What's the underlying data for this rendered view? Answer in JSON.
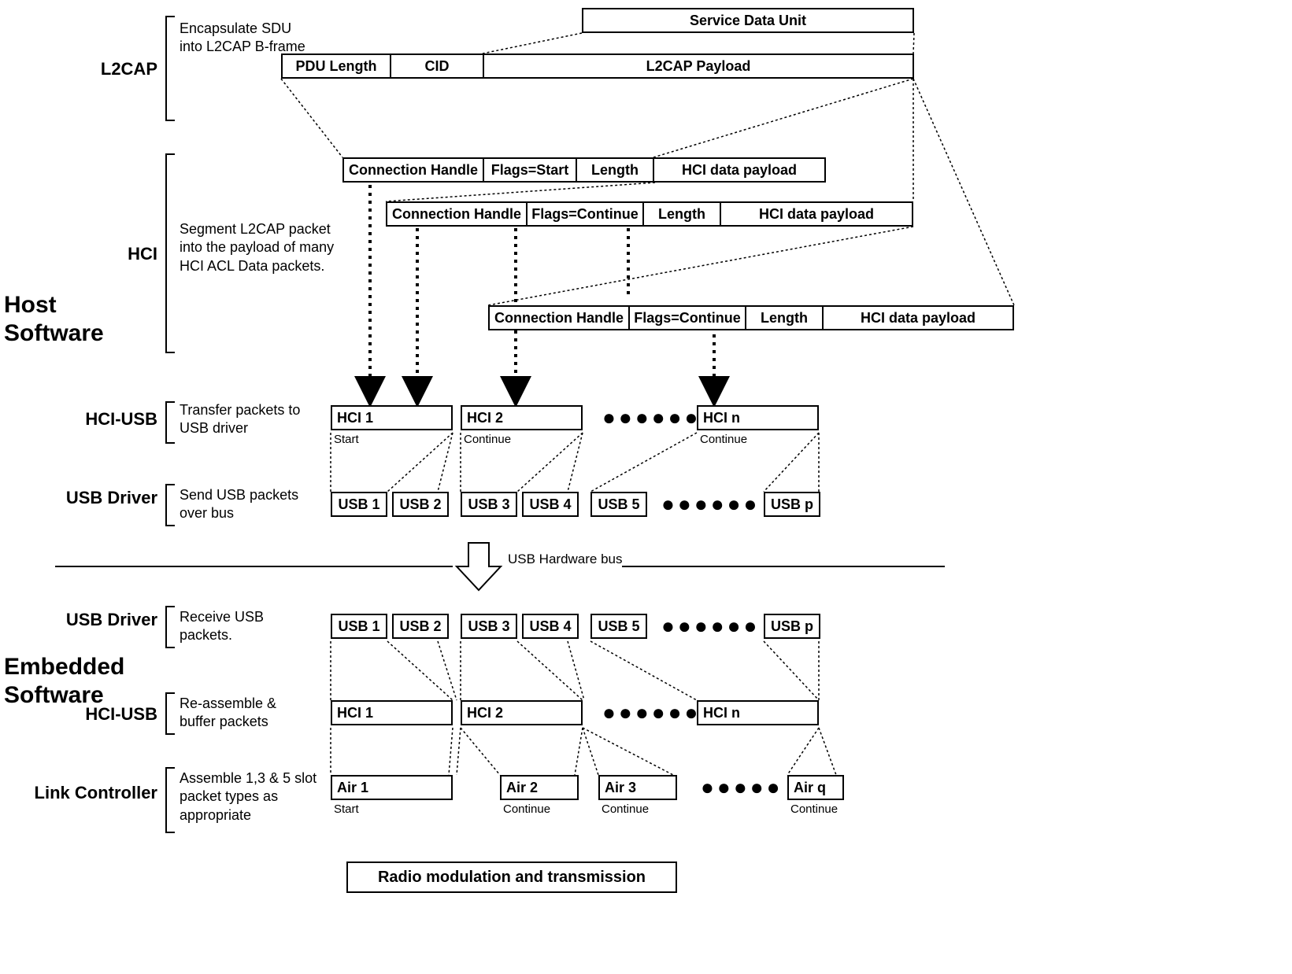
{
  "sections": {
    "host": "Host\nSoftware",
    "embedded": "Embedded\nSoftware"
  },
  "layers": {
    "l2cap": {
      "name": "L2CAP",
      "desc": "Encapsulate SDU into L2CAP B-frame"
    },
    "hci": {
      "name": "HCI",
      "desc": "Segment L2CAP packet into the payload of many HCI ACL Data packets."
    },
    "hci_usb_host": {
      "name": "HCI-USB",
      "desc": "Transfer packets to USB driver"
    },
    "usb_driver_host": {
      "name": "USB Driver",
      "desc": "Send USB packets over bus"
    },
    "usb_driver_emb": {
      "name": "USB Driver",
      "desc": "Receive USB packets."
    },
    "hci_usb_emb": {
      "name": "HCI-USB",
      "desc": "Re-assemble & buffer packets"
    },
    "link_ctrl": {
      "name": "Link Controller",
      "desc": "Assemble 1,3 & 5 slot packet types as appropriate"
    }
  },
  "sdu": "Service Data Unit",
  "l2cap_fields": {
    "pdu_length": "PDU Length",
    "cid": "CID",
    "payload": "L2CAP Payload"
  },
  "hci_fields": {
    "conn_handle": "Connection Handle",
    "flags_start": "Flags=Start",
    "flags_cont": "Flags=Continue",
    "length": "Length",
    "payload": "HCI data payload"
  },
  "hci_blocks": {
    "h1": "HCI 1",
    "h2": "HCI 2",
    "hn": "HCI n"
  },
  "subs": {
    "start": "Start",
    "continue": "Continue"
  },
  "usb_blocks": {
    "u1": "USB 1",
    "u2": "USB 2",
    "u3": "USB 3",
    "u4": "USB 4",
    "u5": "USB 5",
    "up": "USB p"
  },
  "air_blocks": {
    "a1": "Air 1",
    "a2": "Air 2",
    "a3": "Air 3",
    "aq": "Air q"
  },
  "bus_label": "USB Hardware bus",
  "radio": "Radio modulation and transmission"
}
